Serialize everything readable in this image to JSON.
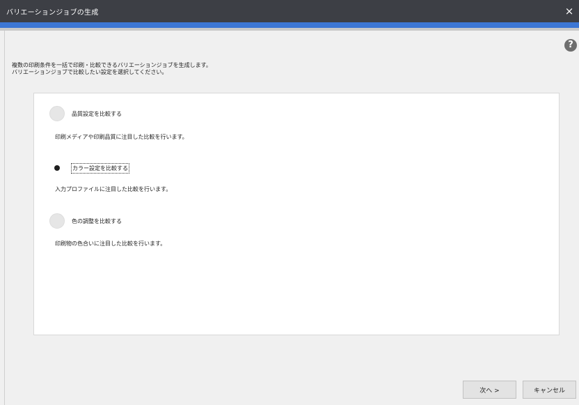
{
  "window": {
    "title": "バリエーションジョブの生成",
    "close_icon": "×"
  },
  "help": {
    "icon": "?"
  },
  "description": {
    "line1": "複数の印刷条件を一括で印刷・比較できるバリエーションジョブを生成します。",
    "line2": "バリエーションジョブで比較したい設定を選択してください。"
  },
  "options": [
    {
      "label": "品質設定を比較する",
      "description": "印刷メディアや印刷品質に注目した比較を行います。",
      "selected": false
    },
    {
      "label": "カラー設定を比較する",
      "description": "入力プロファイルに注目した比較を行います。",
      "selected": true
    },
    {
      "label": "色の調整を比較する",
      "description": "印刷物の色合いに注目した比較を行います。",
      "selected": false
    }
  ],
  "buttons": {
    "next": "次へ >",
    "cancel": "キャンセル"
  },
  "colors": {
    "titlebar": "#3d3f45",
    "accent": "#3d77d5",
    "panel": "#ffffff"
  }
}
